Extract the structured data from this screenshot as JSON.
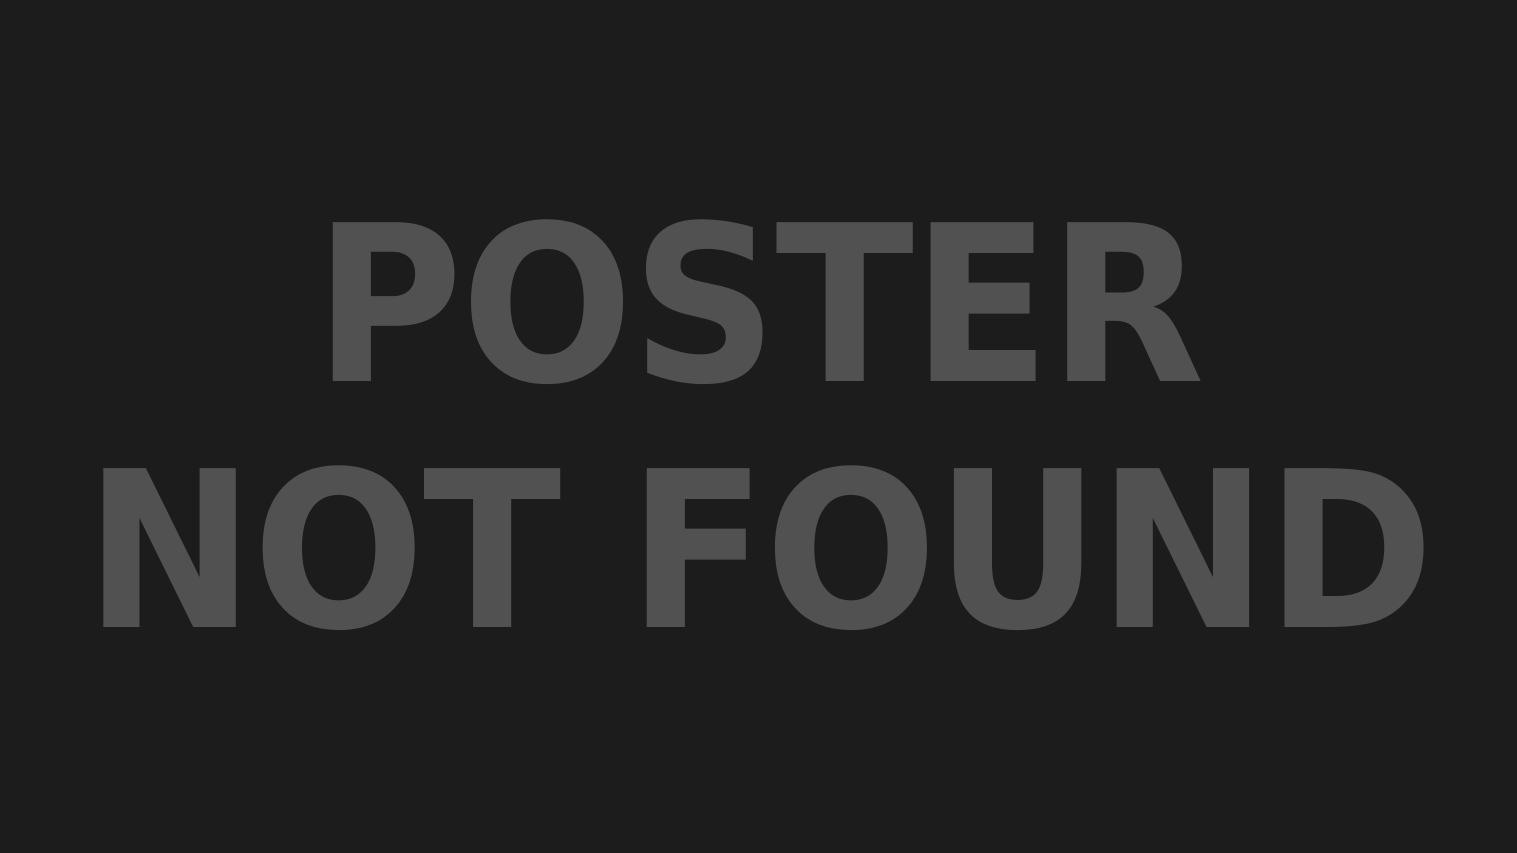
{
  "placeholder": {
    "line1": "POSTER",
    "line2": "NOT FOUND"
  },
  "colors": {
    "background": "#1c1c1c",
    "text": "#515151"
  }
}
